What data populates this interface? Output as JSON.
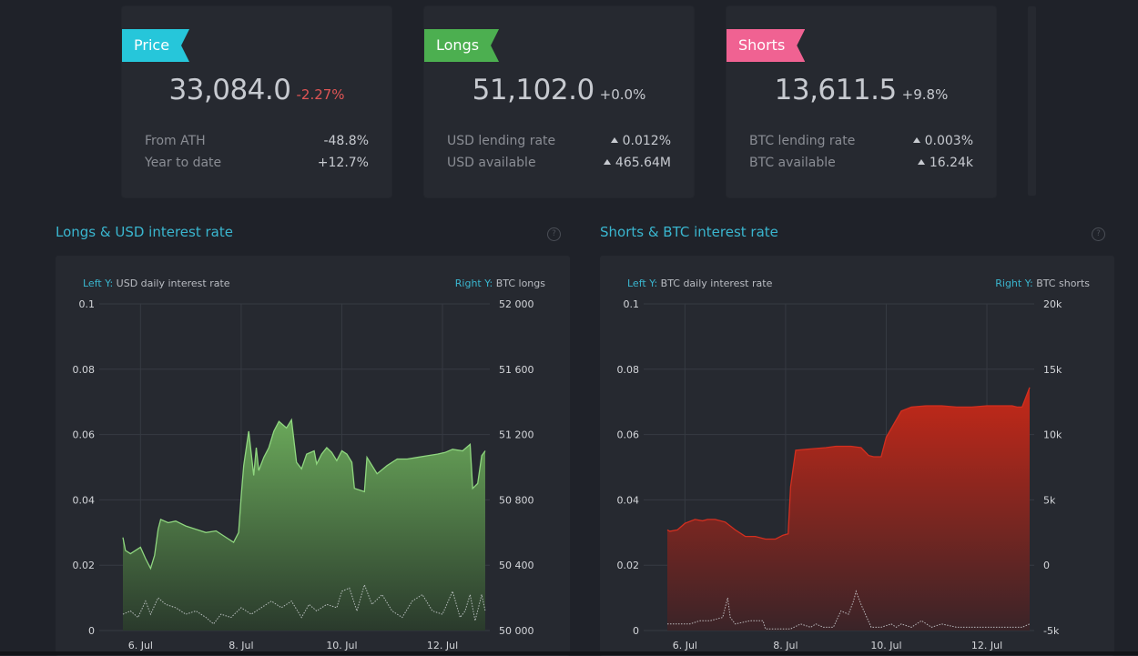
{
  "cards": [
    {
      "tag": "Price",
      "tag_color": "#26c6da",
      "value": "33,084.0",
      "change": "-2.27%",
      "change_color": "#e05555",
      "rows": [
        {
          "label": "From ATH",
          "value": "-48.8%",
          "color": "#e05555",
          "arrow": false
        },
        {
          "label": "Year to date",
          "value": "+12.7%",
          "color": "#5fbf5f",
          "arrow": false
        }
      ]
    },
    {
      "tag": "Longs",
      "tag_color": "#4caf50",
      "value": "51,102.0",
      "change": "+0.0%",
      "change_color": "#c7cad0",
      "rows": [
        {
          "label": "USD lending rate",
          "value": "0.012%",
          "color": "#c7cad0",
          "arrow": true
        },
        {
          "label": "USD available",
          "value": "465.64M",
          "color": "#c7cad0",
          "arrow": true
        }
      ]
    },
    {
      "tag": "Shorts",
      "tag_color": "#f06292",
      "value": "13,611.5",
      "change": "+9.8%",
      "change_color": "#c7cad0",
      "rows": [
        {
          "label": "BTC lending rate",
          "value": "0.003%",
          "color": "#c7cad0",
          "arrow": true
        },
        {
          "label": "BTC available",
          "value": "16.24k",
          "color": "#c7cad0",
          "arrow": true
        }
      ]
    }
  ],
  "sections": [
    {
      "title": "Longs & USD interest rate",
      "help": "?",
      "left_key": "Left Y:",
      "left_label": "USD daily interest rate",
      "right_key": "Right Y:",
      "right_label": "BTC longs"
    },
    {
      "title": "Shorts & BTC interest rate",
      "help": "?",
      "left_key": "Left Y:",
      "left_label": "BTC daily interest rate",
      "right_key": "Right Y:",
      "right_label": "BTC shorts"
    }
  ],
  "chart_data": [
    {
      "type": "area",
      "title": "Longs & USD interest rate",
      "x_ticks": [
        "6. Jul",
        "8. Jul",
        "10. Jul",
        "12. Jul"
      ],
      "x_range_days": [
        5.65,
        12.85
      ],
      "x_tick_days": [
        6,
        8,
        10,
        12
      ],
      "left_axis": {
        "label": "USD daily interest rate",
        "range": [
          0,
          0.1
        ],
        "ticks": [
          "0",
          "0.02",
          "0.04",
          "0.06",
          "0.08",
          "0.1"
        ]
      },
      "right_axis": {
        "label": "BTC longs",
        "range": [
          50000,
          52000
        ],
        "ticks": [
          "50 000",
          "50 400",
          "50 800",
          "51 200",
          "51 600",
          "52 000"
        ]
      },
      "series": [
        {
          "name": "BTC longs",
          "axis": "right",
          "style": "area",
          "color": "#8fd67f",
          "fill_top": "#6aa85a",
          "fill_bottom": "#2a3a2c",
          "x": [
            5.65,
            5.7,
            5.8,
            6.0,
            6.1,
            6.2,
            6.28,
            6.35,
            6.4,
            6.55,
            6.7,
            6.9,
            7.1,
            7.3,
            7.5,
            7.75,
            7.85,
            7.95,
            8.0,
            8.05,
            8.15,
            8.25,
            8.3,
            8.35,
            8.45,
            8.55,
            8.65,
            8.75,
            8.9,
            9.0,
            9.1,
            9.2,
            9.3,
            9.45,
            9.5,
            9.6,
            9.7,
            9.8,
            9.9,
            10.0,
            10.1,
            10.2,
            10.25,
            10.45,
            10.5,
            10.7,
            10.9,
            11.1,
            11.3,
            11.5,
            11.7,
            11.9,
            12.05,
            12.2,
            12.4,
            12.55,
            12.6,
            12.7,
            12.78,
            12.85
          ],
          "values": [
            50570,
            50490,
            50470,
            50510,
            50440,
            50380,
            50460,
            50620,
            50680,
            50660,
            50670,
            50640,
            50620,
            50600,
            50610,
            50560,
            50540,
            50600,
            50820,
            51010,
            51220,
            50950,
            51120,
            50980,
            51060,
            51120,
            51220,
            51280,
            51240,
            51290,
            51030,
            50990,
            51080,
            51100,
            51020,
            51080,
            51120,
            51090,
            51040,
            51100,
            51080,
            51030,
            50870,
            50850,
            51060,
            50960,
            51010,
            51050,
            51050,
            51060,
            51070,
            51080,
            51090,
            51110,
            51100,
            51140,
            50870,
            50900,
            51070,
            51100
          ]
        },
        {
          "name": "USD daily interest rate",
          "axis": "left",
          "style": "dotted",
          "color": "#cfd2d6",
          "x": [
            5.65,
            5.8,
            5.95,
            6.1,
            6.2,
            6.35,
            6.5,
            6.7,
            6.9,
            7.1,
            7.3,
            7.45,
            7.6,
            7.8,
            8.0,
            8.2,
            8.4,
            8.6,
            8.8,
            9.0,
            9.2,
            9.35,
            9.5,
            9.7,
            9.9,
            10.0,
            10.15,
            10.3,
            10.45,
            10.6,
            10.8,
            11.0,
            11.2,
            11.4,
            11.6,
            11.8,
            12.0,
            12.2,
            12.35,
            12.45,
            12.55,
            12.65,
            12.78,
            12.85
          ],
          "values": [
            0.005,
            0.006,
            0.004,
            0.009,
            0.005,
            0.01,
            0.008,
            0.007,
            0.005,
            0.006,
            0.004,
            0.002,
            0.005,
            0.004,
            0.007,
            0.005,
            0.007,
            0.009,
            0.007,
            0.009,
            0.004,
            0.008,
            0.006,
            0.008,
            0.007,
            0.012,
            0.013,
            0.006,
            0.014,
            0.008,
            0.011,
            0.006,
            0.004,
            0.009,
            0.011,
            0.006,
            0.005,
            0.012,
            0.004,
            0.006,
            0.011,
            0.003,
            0.011,
            0.006
          ]
        }
      ]
    },
    {
      "type": "area",
      "title": "Shorts & BTC interest rate",
      "x_ticks": [
        "6. Jul",
        "8. Jul",
        "10. Jul",
        "12. Jul"
      ],
      "x_range_days": [
        5.65,
        12.85
      ],
      "x_tick_days": [
        6,
        8,
        10,
        12
      ],
      "left_axis": {
        "label": "BTC daily interest rate",
        "range": [
          0,
          0.1
        ],
        "ticks": [
          "0",
          "0.02",
          "0.04",
          "0.06",
          "0.08",
          "0.1"
        ]
      },
      "right_axis": {
        "label": "BTC shorts",
        "range": [
          -5000,
          20000
        ],
        "ticks": [
          "-5k",
          "0",
          "5k",
          "10k",
          "15k",
          "20k"
        ]
      },
      "series": [
        {
          "name": "BTC shorts",
          "axis": "right",
          "style": "area",
          "color": "#d32f1f",
          "fill_top": "#c62818",
          "fill_bottom": "#3a2428",
          "x": [
            5.65,
            5.7,
            5.85,
            6.0,
            6.2,
            6.35,
            6.45,
            6.6,
            6.8,
            7.0,
            7.2,
            7.4,
            7.6,
            7.8,
            7.95,
            8.05,
            8.1,
            8.2,
            8.5,
            8.8,
            9.0,
            9.3,
            9.5,
            9.65,
            9.75,
            9.9,
            10.0,
            10.3,
            10.5,
            10.8,
            11.1,
            11.4,
            11.7,
            12.0,
            12.2,
            12.4,
            12.5,
            12.6,
            12.7,
            12.78,
            12.85
          ],
          "values": [
            2700,
            2600,
            2700,
            3200,
            3500,
            3400,
            3500,
            3500,
            3300,
            2700,
            2200,
            2200,
            2000,
            2000,
            2300,
            2400,
            6000,
            8800,
            8900,
            9000,
            9100,
            9100,
            9000,
            8400,
            8300,
            8300,
            9800,
            11800,
            12100,
            12200,
            12200,
            12100,
            12100,
            12200,
            12200,
            12200,
            12200,
            12100,
            12100,
            12900,
            13600
          ]
        },
        {
          "name": "BTC daily interest rate",
          "axis": "left",
          "style": "dotted",
          "color": "#cfd2d6",
          "x": [
            5.65,
            5.9,
            6.1,
            6.3,
            6.5,
            6.75,
            6.85,
            6.9,
            7.0,
            7.3,
            7.55,
            7.6,
            7.9,
            8.1,
            8.3,
            8.5,
            8.6,
            8.75,
            8.8,
            8.95,
            9.1,
            9.25,
            9.35,
            9.4,
            9.5,
            9.7,
            9.9,
            10.1,
            10.2,
            10.3,
            10.5,
            10.7,
            10.9,
            11.1,
            11.4,
            11.7,
            12.0,
            12.2,
            12.5,
            12.7,
            12.85
          ],
          "values": [
            0.002,
            0.002,
            0.002,
            0.003,
            0.003,
            0.004,
            0.01,
            0.004,
            0.002,
            0.003,
            0.003,
            0.0005,
            0.0005,
            0.0005,
            0.002,
            0.001,
            0.002,
            0.001,
            0.001,
            0.001,
            0.006,
            0.005,
            0.009,
            0.012,
            0.008,
            0.001,
            0.001,
            0.002,
            0.001,
            0.002,
            0.001,
            0.003,
            0.001,
            0.002,
            0.001,
            0.001,
            0.001,
            0.001,
            0.001,
            0.001,
            0.002
          ]
        }
      ]
    }
  ]
}
